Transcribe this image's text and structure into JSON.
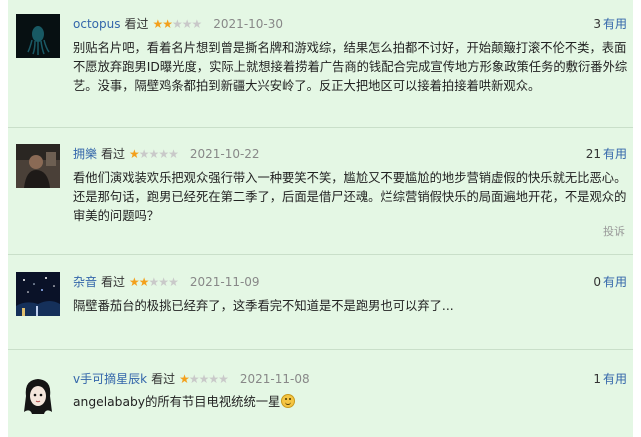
{
  "comments": [
    {
      "user": "octopus",
      "action": "看过",
      "stars": 2,
      "time": "2021-10-30",
      "votes": "3",
      "vote_label": "有用",
      "text": "别贴名片吧，看着名片想到曾是撕名牌和游戏综，结果怎么拍都不讨好，开始颠簸打滚不伦不类，表面不愿放弃跑男ID曝光度，实际上就想接着捞着广告商的钱配合完成宣传地方形象政策任务的敷衍番外综艺。没事，隔壁鸡条都拍到新疆大兴安岭了。反正大把地区可以接着拍接着哄新观众。",
      "avatar_icon": "dark-octopus-avatar"
    },
    {
      "user": "拥樂",
      "action": "看过",
      "stars": 1,
      "time": "2021-10-22",
      "votes": "21",
      "vote_label": "有用",
      "text": "看他们演戏装欢乐把观众强行带入一种要笑不笑，尴尬又不要尴尬的地步营销虚假的快乐就无比恶心。还是那句话，跑男已经死在第二季了，后面是借尸还魂。烂综营销假快乐的局面遍地开花，不是观众的审美的问题吗？",
      "report": "投诉",
      "avatar_icon": "person-photo-avatar"
    },
    {
      "user": "杂音",
      "action": "看过",
      "stars": 2,
      "time": "2021-11-09",
      "votes": "0",
      "vote_label": "有用",
      "text": "隔壁番茄台的极挑已经弃了，这季看完不知道是不是跑男也可以弃了...",
      "avatar_icon": "night-scene-avatar"
    },
    {
      "user": "v手可摘星辰k",
      "action": "看过",
      "stars": 1,
      "time": "2021-11-08",
      "votes": "1",
      "vote_label": "有用",
      "text": "angelababy的所有节目电视统统一星",
      "emoji": "smile-emoji",
      "avatar_icon": "cartoon-girl-avatar"
    }
  ],
  "colors": {
    "background": "#e4f7e4",
    "username": "#3366aa",
    "star_on": "#f3a01b",
    "star_off": "#c9c9c9",
    "time": "#888888"
  }
}
